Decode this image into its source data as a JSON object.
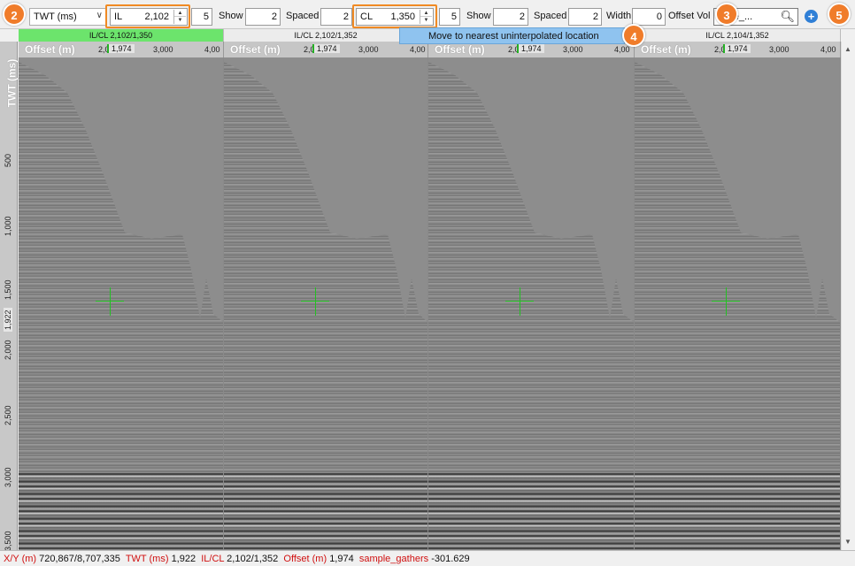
{
  "toolbar": {
    "domain_select": "TWT (ms)",
    "il_prefix": "IL",
    "il_value": "2,102",
    "il_step": "5",
    "show_label_1": "Show",
    "show_value_1": "2",
    "spaced_label_1": "Spaced",
    "spaced_value_1": "2",
    "cl_prefix": "CL",
    "cl_value": "1,350",
    "cl_step": "5",
    "show_label_2": "Show",
    "show_value_2": "2",
    "spaced_label_2": "Spaced",
    "spaced_value_2": "2",
    "width_label": "Width",
    "width_value": "0",
    "offset_vol_label": "Offset Vol",
    "offset_vol_value": "mple_..."
  },
  "callouts": {
    "c2": "2",
    "c3": "3",
    "c4": "4",
    "c5": "5"
  },
  "tooltip": "Move to nearest uninterpolated location",
  "panels": [
    {
      "title": "IL/CL 2,102/1,350",
      "active": true
    },
    {
      "title": "IL/CL 2,102/1,352",
      "active": false
    },
    {
      "title": "",
      "active": false
    },
    {
      "title": "IL/CL 2,104/1,352",
      "active": false
    }
  ],
  "offset_axis": {
    "title": "Offset (m)",
    "ticks": [
      "2,0",
      "3,000",
      "4,00"
    ],
    "current": "1,974"
  },
  "time_axis": {
    "title": "TWT (ms)",
    "ticks": [
      "500",
      "1,000",
      "1,500",
      "1,922",
      "2,000",
      "2,500",
      "3,000",
      "3,500"
    ],
    "current": "1,922"
  },
  "status": {
    "xy_label": "X/Y (m)",
    "xy_value": "720,867/8,707,335",
    "twt_label": "TWT (ms)",
    "twt_value": "1,922",
    "ilcl_label": "IL/CL",
    "ilcl_value": "2,102/1,352",
    "offset_label": "Offset (m)",
    "offset_value": "1,974",
    "gathers_label": "sample_gathers",
    "gathers_value": "-301.629"
  },
  "colors": {
    "accent": "#f08a24",
    "active_panel": "#6ce46c",
    "crosshair": "#22c022",
    "tooltip_bg": "#8fc3ef",
    "status_key": "#d01010"
  }
}
